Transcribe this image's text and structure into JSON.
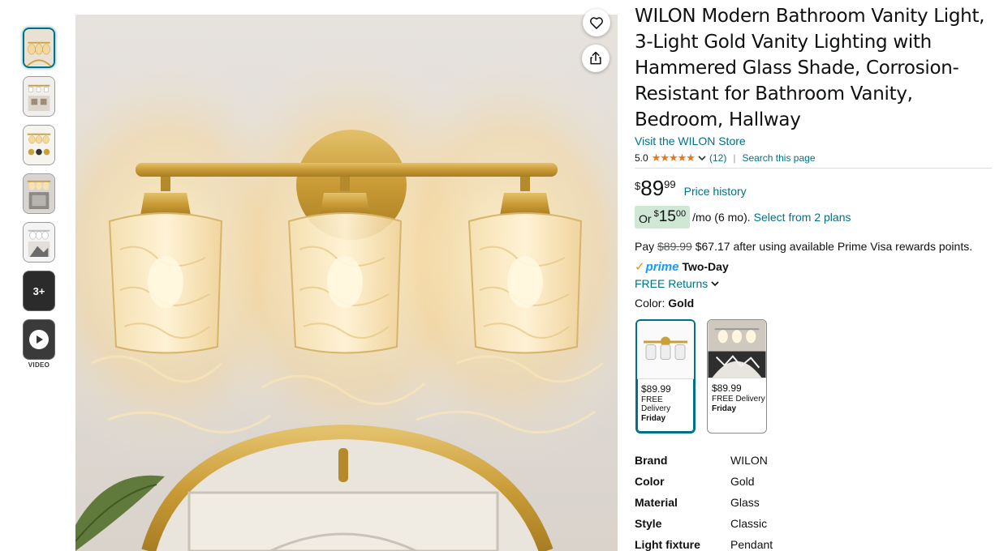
{
  "thumbnails": [
    {
      "name": "thumb-1"
    },
    {
      "name": "thumb-2"
    },
    {
      "name": "thumb-3"
    },
    {
      "name": "thumb-4"
    },
    {
      "name": "thumb-5"
    }
  ],
  "more_thumbs_label": "3+",
  "video_label": "VIDEO",
  "product": {
    "title": "WILON Modern Bathroom Vanity Light, 3-Light Gold Vanity Lighting with Hammered Glass Shade, Corrosion-Resistant for Bathroom Vanity, Bedroom, Hallway",
    "store_link": "Visit the WILON Store",
    "rating_value": "5.0",
    "stars": "★★★★★",
    "rating_count": "(12)",
    "search_page_link": "Search this page"
  },
  "price": {
    "currency": "$",
    "whole": "89",
    "fraction": "99",
    "history_link": "Price history"
  },
  "installment": {
    "or_label": "Or",
    "currency": "$",
    "whole": "15",
    "fraction": "00",
    "term": "/mo (6 mo).",
    "plans_link": "Select from 2 plans"
  },
  "prime_visa": {
    "pay_label": "Pay",
    "original": "$89.99",
    "after_text": "$67.17 after using available Prime Visa rewards points."
  },
  "delivery": {
    "check": "✓",
    "prime_label": "prime",
    "speed": "Two-Day",
    "returns_link": "FREE Returns"
  },
  "color": {
    "label": "Color:",
    "selected": "Gold"
  },
  "swatches": [
    {
      "price": "$89.99",
      "delivery": "FREE Delivery",
      "day": "Friday"
    },
    {
      "price": "$89.99",
      "delivery": "FREE Delivery",
      "day": "Friday"
    }
  ],
  "specs": [
    {
      "key": "Brand",
      "value": "WILON"
    },
    {
      "key": "Color",
      "value": "Gold"
    },
    {
      "key": "Material",
      "value": "Glass"
    },
    {
      "key": "Style",
      "value": "Classic"
    },
    {
      "key": "Light fixture",
      "value": "Pendant"
    }
  ],
  "colors": {
    "link": "#007185",
    "star": "#de7921",
    "prime": "#1399ff",
    "installment_bg": "#cfe8d6",
    "gold": "#c9a03c"
  },
  "icons": {
    "favorite": "heart-icon",
    "share": "share-icon",
    "play": "play-icon",
    "dropdown": "chevron-down-icon"
  }
}
